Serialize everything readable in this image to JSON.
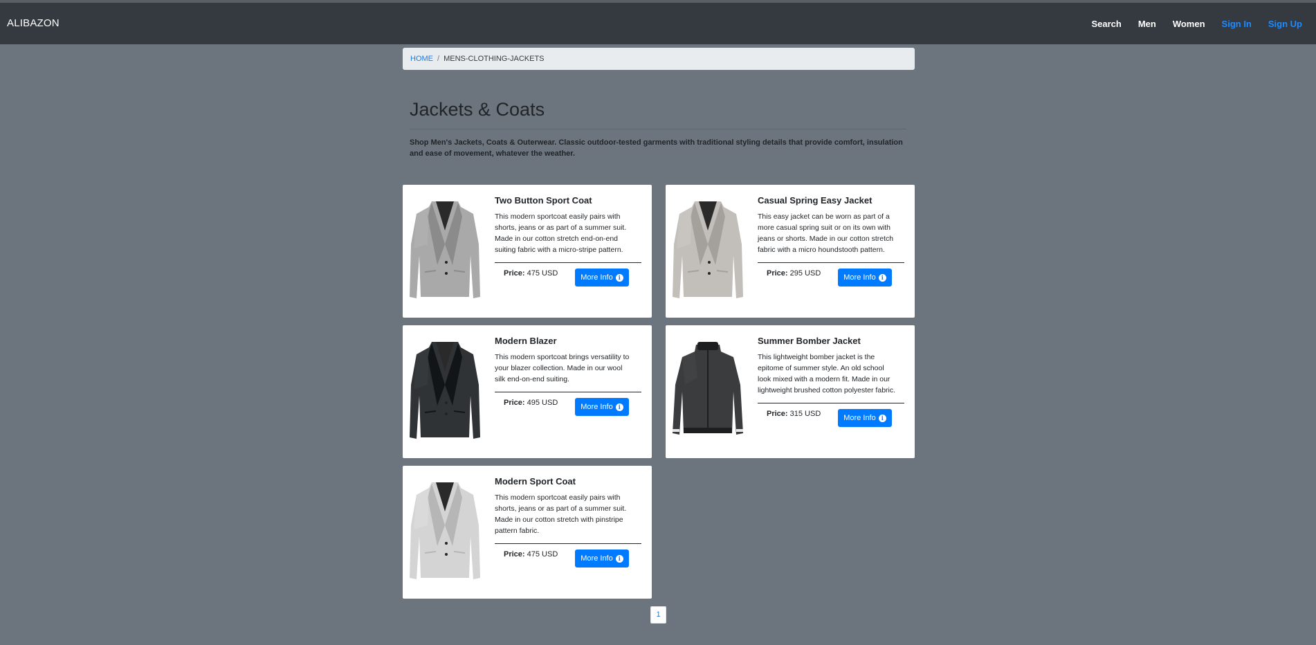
{
  "navbar": {
    "brand": "ALIBAZON",
    "links": [
      {
        "label": "Search"
      },
      {
        "label": "Men"
      },
      {
        "label": "Women"
      },
      {
        "label": "Sign In"
      },
      {
        "label": "Sign Up"
      }
    ]
  },
  "breadcrumb": {
    "home": "HOME",
    "separator": "/",
    "current": "MENS-CLOTHING-JACKETS"
  },
  "page": {
    "title": "Jackets & Coats",
    "description": "Shop Men's Jackets, Coats & Outerwear. Classic outdoor-tested garments with traditional styling details that provide comfort, insulation and ease of movement, whatever the weather."
  },
  "products": [
    {
      "name": "Two Button Sport Coat",
      "description": "This modern sportcoat easily pairs with shorts, jeans or as part of a summer suit. Made in our cotton stretch end-on-end suiting fabric with a micro-stripe pattern.",
      "price_label": "Price:",
      "price": "475 USD",
      "button": "More Info",
      "image_color": "#a9a9a9",
      "image_style": "sportcoat"
    },
    {
      "name": "Casual Spring Easy Jacket",
      "description": "This easy jacket can be worn as part of a more casual spring suit or on its own with jeans or shorts. Made in our cotton stretch fabric with a micro houndstooth pattern.",
      "price_label": "Price:",
      "price": "295 USD",
      "button": "More Info",
      "image_color": "#c2bfba",
      "image_style": "sportcoat"
    },
    {
      "name": "Modern Blazer",
      "description": "This modern sportcoat brings versatility to your blazer collection. Made in our wool silk end-on-end suiting.",
      "price_label": "Price:",
      "price": "495 USD",
      "button": "More Info",
      "image_color": "#2f3336",
      "image_style": "sportcoat"
    },
    {
      "name": "Summer Bomber Jacket",
      "description": "This lightweight bomber jacket is the epitome of summer style. An old school look mixed with a modern fit. Made in our lightweight brushed cotton polyester fabric.",
      "price_label": "Price:",
      "price": "315 USD",
      "button": "More Info",
      "image_color": "#3a3c3e",
      "image_style": "bomber"
    },
    {
      "name": "Modern Sport Coat",
      "description": "This modern sportcoat easily pairs with shorts, jeans or as part of a summer suit. Made in our cotton stretch with pinstripe pattern fabric.",
      "price_label": "Price:",
      "price": "475 USD",
      "button": "More Info",
      "image_color": "#d4d4d4",
      "image_style": "sportcoat"
    }
  ],
  "pagination": {
    "current_page": "1"
  },
  "icons": {
    "info": "info-circle-icon"
  },
  "colors": {
    "navbar": "#343a40",
    "background": "#6c757d",
    "primary": "#007bff",
    "link": "#1e8bff"
  }
}
